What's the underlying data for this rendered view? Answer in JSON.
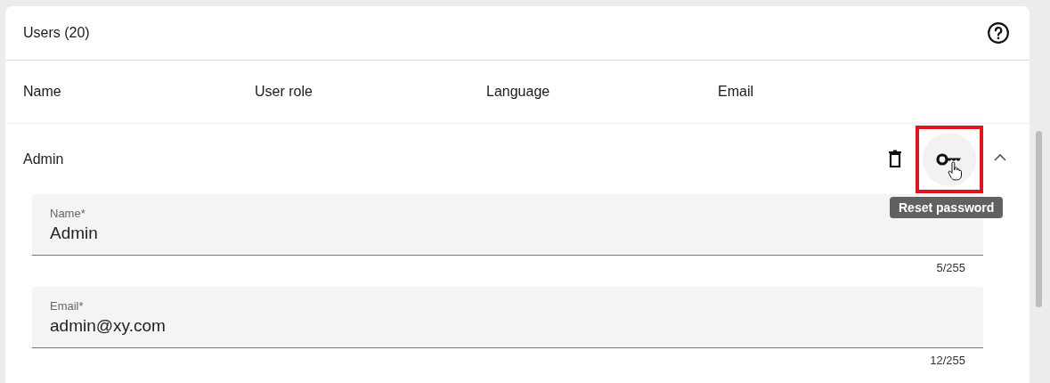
{
  "card": {
    "title": "Users (20)"
  },
  "table": {
    "columns": [
      "Name",
      "User role",
      "Language",
      "Email"
    ],
    "rows": [
      {
        "name": "Admin",
        "expanded": true,
        "actions": [
          {
            "kind": "delete",
            "highlighted": false
          },
          {
            "kind": "key",
            "highlighted": true,
            "tooltip": "Reset password"
          }
        ],
        "fields": [
          {
            "label": "Name*",
            "value": "Admin",
            "counter": "5/255"
          },
          {
            "label": "Email*",
            "value": "admin@xy.com",
            "counter": "12/255"
          }
        ]
      }
    ]
  }
}
